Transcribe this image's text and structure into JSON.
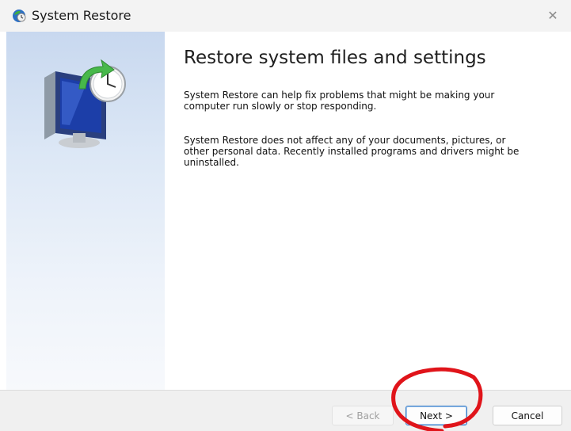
{
  "window": {
    "title": "System Restore",
    "close_glyph": "✕"
  },
  "content": {
    "heading": "Restore system files and settings",
    "paragraph1": "System Restore can help fix problems that might be making your computer run slowly or stop responding.",
    "paragraph2": "System Restore does not affect any of your documents, pictures, or other personal data. Recently installed programs and drivers might be uninstalled."
  },
  "buttons": {
    "back": "< Back",
    "next": "Next >",
    "cancel": "Cancel"
  },
  "colors": {
    "side_panel_top": "#c8d8ef",
    "annotation_circle": "#e0141a",
    "default_button_border": "#3c7fc8"
  }
}
